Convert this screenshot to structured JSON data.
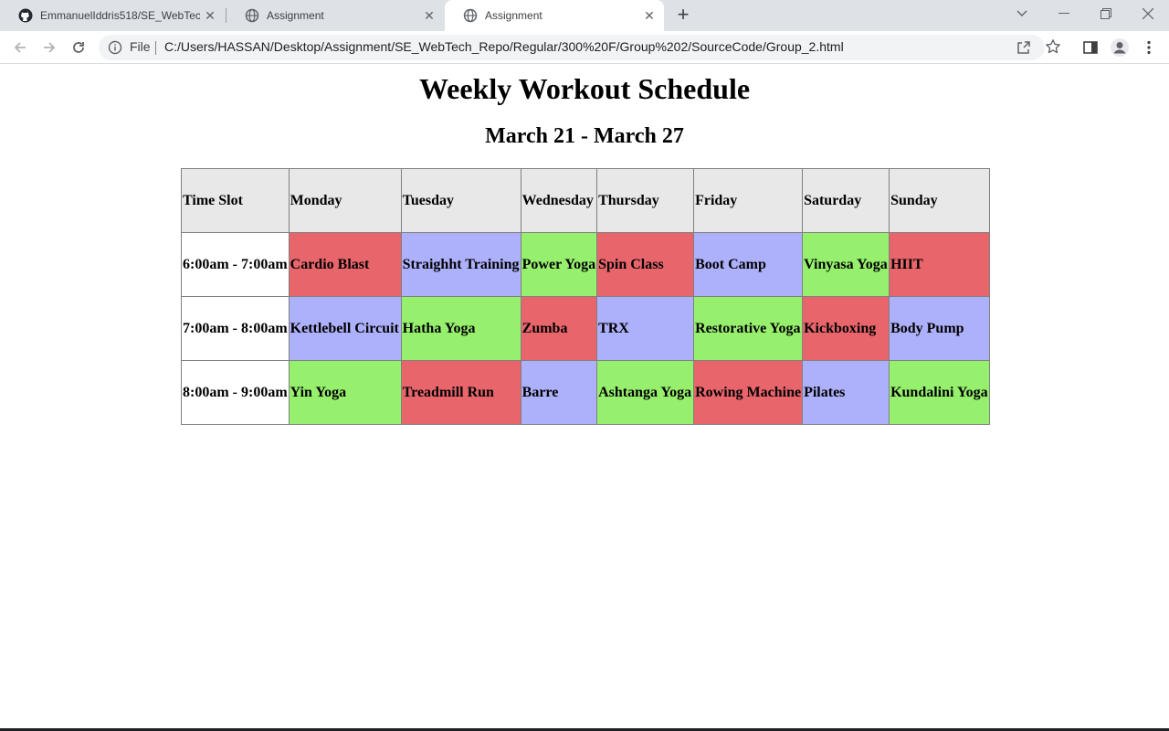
{
  "browser": {
    "tabs": [
      {
        "title": "EmmanuelIddris518/SE_WebTech",
        "icon": "github-icon",
        "active": false
      },
      {
        "title": "Assignment",
        "icon": "globe-icon",
        "active": false
      },
      {
        "title": "Assignment",
        "icon": "globe-icon",
        "active": true
      }
    ],
    "address": {
      "scheme_label": "File",
      "url": "C:/Users/HASSAN/Desktop/Assignment/SE_WebTech_Repo/Regular/300%20F/Group%202/SourceCode/Group_2.html"
    }
  },
  "page": {
    "title": "Weekly Workout Schedule",
    "subtitle": "March 21 - March 27"
  },
  "schedule": {
    "headers": [
      "Time Slot",
      "Monday",
      "Tuesday",
      "Wednesday",
      "Thursday",
      "Friday",
      "Saturday",
      "Sunday"
    ],
    "rows": [
      {
        "time": "6:00am - 7:00am",
        "cells": [
          "Cardio Blast",
          "Straighht Training",
          "Power Yoga",
          "Spin Class",
          "Boot Camp",
          "Vinyasa Yoga",
          "HIIT"
        ]
      },
      {
        "time": "7:00am - 8:00am",
        "cells": [
          "Kettlebell Circuit",
          "Hatha Yoga",
          "Zumba",
          "TRX",
          "Restorative Yoga",
          "Kickboxing",
          "Body Pump"
        ]
      },
      {
        "time": "8:00am - 9:00am",
        "cells": [
          "Yin Yoga",
          "Treadmill Run",
          "Barre",
          "Ashtanga Yoga",
          "Rowing Machine",
          "Pilates",
          "Kundalini Yoga"
        ]
      }
    ],
    "cell_colors": [
      [
        "#e8656b",
        "#adb0fa",
        "#96f06e",
        "#e8656b",
        "#adb0fa",
        "#96f06e",
        "#e8656b"
      ],
      [
        "#adb0fa",
        "#96f06e",
        "#e8656b",
        "#adb0fa",
        "#96f06e",
        "#e8656b",
        "#adb0fa"
      ],
      [
        "#96f06e",
        "#e8656b",
        "#adb0fa",
        "#96f06e",
        "#e8656b",
        "#adb0fa",
        "#96f06e"
      ]
    ]
  }
}
